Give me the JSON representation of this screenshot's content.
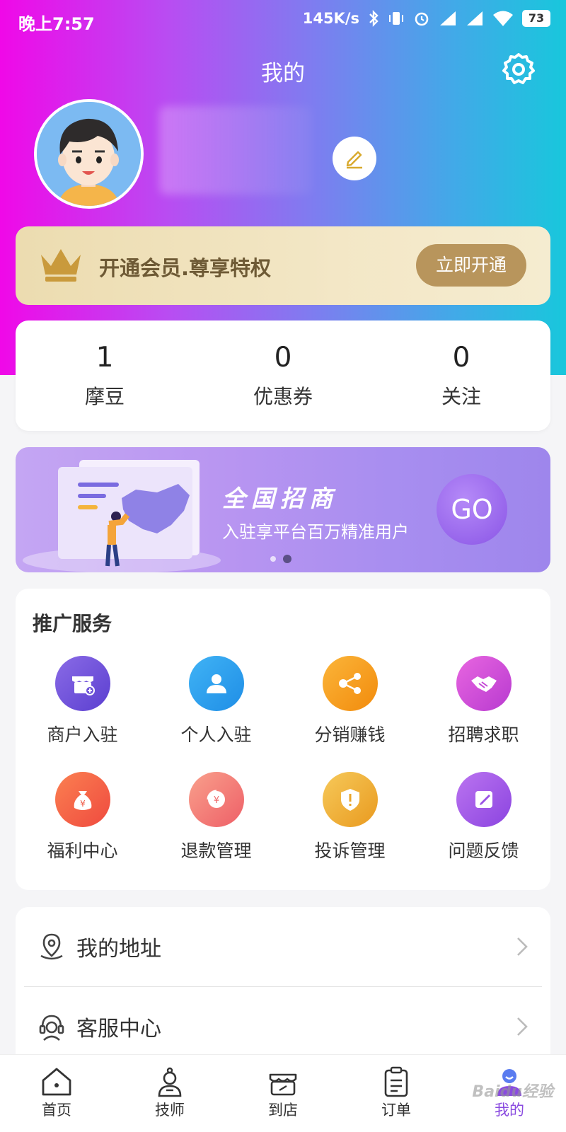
{
  "status_bar": {
    "time": "晚上7:57",
    "speed": "145K/s",
    "battery": "73"
  },
  "header": {
    "title": "我的"
  },
  "vip": {
    "text": "开通会员.尊享特权",
    "button": "立即开通"
  },
  "stats": [
    {
      "value": "1",
      "label": "摩豆"
    },
    {
      "value": "0",
      "label": "优惠券"
    },
    {
      "value": "0",
      "label": "关注"
    }
  ],
  "banner": {
    "title": "全国招商",
    "subtitle": "入驻享平台百万精准用户",
    "go": "GO"
  },
  "services": {
    "title": "推广服务",
    "items": [
      {
        "label": "商户入驻",
        "icon": "store-icon",
        "color": "#6d52d8"
      },
      {
        "label": "个人入驻",
        "icon": "person-icon",
        "color": "#2ea2f0"
      },
      {
        "label": "分销赚钱",
        "icon": "share-icon",
        "color": "#f6a21b"
      },
      {
        "label": "招聘求职",
        "icon": "handshake-icon",
        "color": "#d14fd8"
      },
      {
        "label": "福利中心",
        "icon": "money-bag-icon",
        "color": "#f4604a"
      },
      {
        "label": "退款管理",
        "icon": "refund-icon",
        "color": "#f27a6e"
      },
      {
        "label": "投诉管理",
        "icon": "shield-icon",
        "color": "#f0ae2a"
      },
      {
        "label": "问题反馈",
        "icon": "edit-icon",
        "color": "#a45ae6"
      }
    ]
  },
  "menu": [
    {
      "label": "我的地址",
      "icon": "location-icon"
    },
    {
      "label": "客服中心",
      "icon": "headset-icon"
    }
  ],
  "tabs": [
    {
      "label": "首页",
      "icon": "home-icon"
    },
    {
      "label": "技师",
      "icon": "technician-icon"
    },
    {
      "label": "到店",
      "icon": "shop-icon"
    },
    {
      "label": "订单",
      "icon": "order-icon"
    },
    {
      "label": "我的",
      "icon": "profile-icon",
      "active": true
    }
  ],
  "watermark": "Baidu经验"
}
